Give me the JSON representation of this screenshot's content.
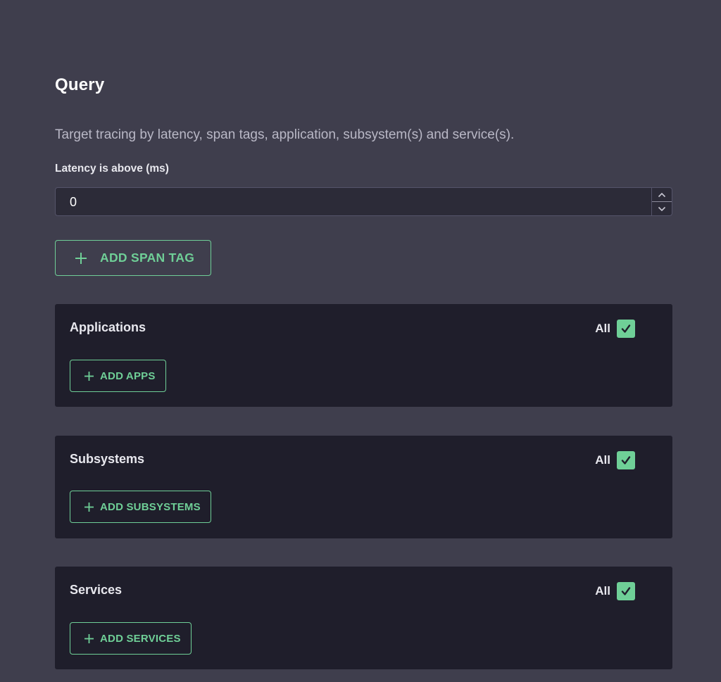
{
  "colors": {
    "background": "#3f3e4d",
    "card": "#1f1e2b",
    "accent": "#6fcf97",
    "muted_text": "#b9b8c6"
  },
  "header": {
    "title": "Query",
    "description": "Target tracing by latency, span tags, application, subsystem(s) and service(s)."
  },
  "latency": {
    "label": "Latency is above (ms)",
    "value": "0"
  },
  "add_span_tag": {
    "label": "ADD SPAN TAG",
    "icon": "plus-icon"
  },
  "sections": [
    {
      "title": "Applications",
      "all_label": "All",
      "all_checked": true,
      "button_label": "ADD APPS"
    },
    {
      "title": "Subsystems",
      "all_label": "All",
      "all_checked": true,
      "button_label": "ADD SUBSYSTEMS"
    },
    {
      "title": "Services",
      "all_label": "All",
      "all_checked": true,
      "button_label": "ADD SERVICES"
    }
  ]
}
